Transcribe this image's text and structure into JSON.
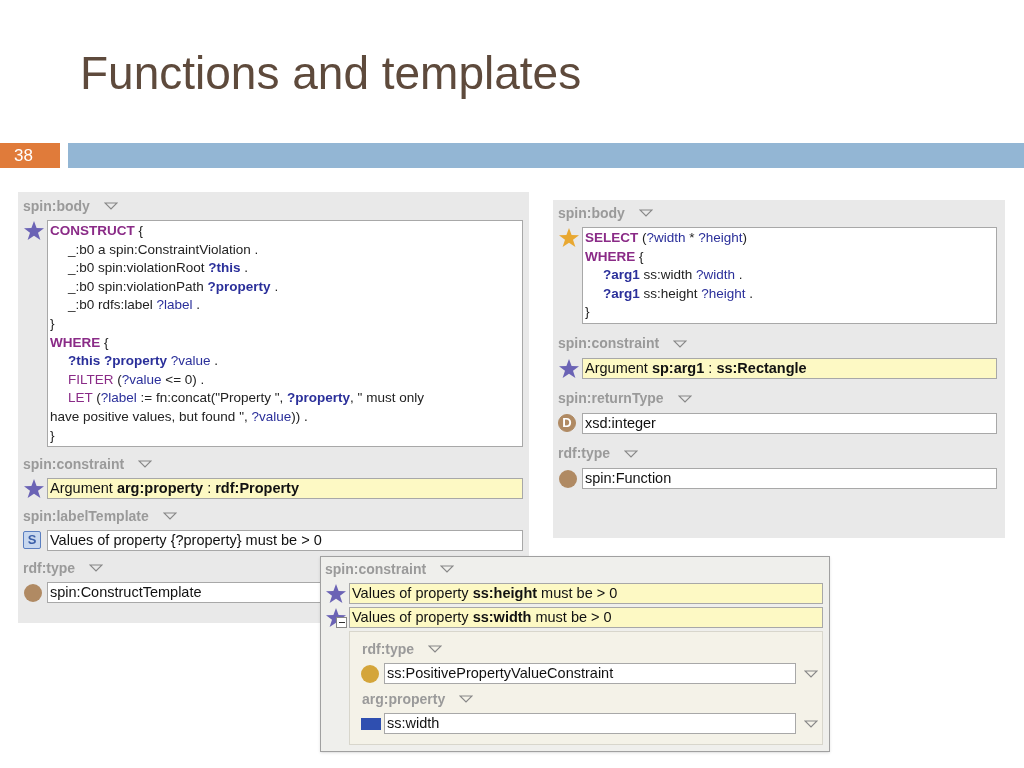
{
  "slide": {
    "title": "Functions and templates",
    "number": "38"
  },
  "panels": [
    {
      "properties": [
        {
          "label": "spin:body",
          "values": [
            {
              "kind": "code",
              "icon": {
                "kind": "star",
                "color": "#6b63b5"
              },
              "lines": [
                {
                  "indented": false,
                  "tokens": [
                    {
                      "kind": "keyword",
                      "text": "CONSTRUCT"
                    },
                    {
                      "kind": "plain",
                      "text": " {"
                    }
                  ]
                },
                {
                  "indented": true,
                  "tokens": [
                    {
                      "kind": "plain",
                      "text": "_:b0 a spin:ConstraintViolation ."
                    }
                  ]
                },
                {
                  "indented": true,
                  "tokens": [
                    {
                      "kind": "plain",
                      "text": "_:b0 spin:violationRoot "
                    },
                    {
                      "kind": "boundvar",
                      "text": "?this"
                    },
                    {
                      "kind": "plain",
                      "text": " ."
                    }
                  ]
                },
                {
                  "indented": true,
                  "tokens": [
                    {
                      "kind": "plain",
                      "text": "_:b0 spin:violationPath "
                    },
                    {
                      "kind": "boundvar",
                      "text": "?property"
                    },
                    {
                      "kind": "plain",
                      "text": " ."
                    }
                  ]
                },
                {
                  "indented": true,
                  "tokens": [
                    {
                      "kind": "plain",
                      "text": "_:b0 rdfs:label "
                    },
                    {
                      "kind": "var",
                      "text": "?label"
                    },
                    {
                      "kind": "plain",
                      "text": " ."
                    }
                  ]
                },
                {
                  "indented": false,
                  "tokens": [
                    {
                      "kind": "plain",
                      "text": "}"
                    }
                  ]
                },
                {
                  "indented": false,
                  "tokens": [
                    {
                      "kind": "keyword",
                      "text": "WHERE"
                    },
                    {
                      "kind": "plain",
                      "text": " {"
                    }
                  ]
                },
                {
                  "indented": true,
                  "tokens": [
                    {
                      "kind": "boundvar",
                      "text": "?this ?property"
                    },
                    {
                      "kind": "var",
                      "text": " ?value"
                    },
                    {
                      "kind": "plain",
                      "text": " ."
                    }
                  ]
                },
                {
                  "indented": true,
                  "tokens": [
                    {
                      "kind": "function",
                      "text": "FILTER"
                    },
                    {
                      "kind": "plain",
                      "text": " ("
                    },
                    {
                      "kind": "var",
                      "text": "?value"
                    },
                    {
                      "kind": "plain",
                      "text": " <= 0) ."
                    }
                  ]
                },
                {
                  "indented": true,
                  "tokens": [
                    {
                      "kind": "function",
                      "text": "LET"
                    },
                    {
                      "kind": "plain",
                      "text": " ("
                    },
                    {
                      "kind": "var",
                      "text": "?label"
                    },
                    {
                      "kind": "plain",
                      "text": " := fn:concat(\"Property \", "
                    },
                    {
                      "kind": "boundvar",
                      "text": "?property"
                    },
                    {
                      "kind": "plain",
                      "text": ", \" must only"
                    }
                  ]
                },
                {
                  "indented": false,
                  "tokens": [
                    {
                      "kind": "plain",
                      "text": "have positive values, but found \", "
                    },
                    {
                      "kind": "var",
                      "text": "?value"
                    },
                    {
                      "kind": "plain",
                      "text": ")) ."
                    }
                  ]
                },
                {
                  "indented": false,
                  "tokens": [
                    {
                      "kind": "plain",
                      "text": "}"
                    }
                  ]
                }
              ]
            }
          ]
        },
        {
          "label": "spin:constraint",
          "values": [
            {
              "kind": "text",
              "icon": {
                "kind": "star",
                "color": "#6b63b5"
              },
              "text": "Argument **arg:property** : **rdf:Property**",
              "highlighted": true,
              "dropdown": false
            }
          ]
        },
        {
          "label": "spin:labelTemplate",
          "values": [
            {
              "kind": "text",
              "icon": {
                "kind": "letter",
                "letter": "S",
                "color": "#5b7fc0"
              },
              "text": "Values of property {?property} must be > 0",
              "highlighted": false,
              "dropdown": false
            }
          ]
        },
        {
          "label": "rdf:type",
          "values": [
            {
              "kind": "text",
              "icon": {
                "kind": "dot",
                "color": "#b08a63"
              },
              "text": "spin:ConstructTemplate",
              "highlighted": false,
              "dropdown": false
            }
          ]
        }
      ]
    },
    {
      "properties": [
        {
          "label": "spin:body",
          "values": [
            {
              "kind": "code",
              "icon": {
                "kind": "star",
                "color": "#e8a832"
              },
              "lines": [
                {
                  "indented": false,
                  "tokens": [
                    {
                      "kind": "keyword",
                      "text": "SELECT"
                    },
                    {
                      "kind": "plain",
                      "text": " ("
                    },
                    {
                      "kind": "var",
                      "text": "?width"
                    },
                    {
                      "kind": "plain",
                      "text": " * "
                    },
                    {
                      "kind": "var",
                      "text": "?height"
                    },
                    {
                      "kind": "plain",
                      "text": ")"
                    }
                  ]
                },
                {
                  "indented": false,
                  "tokens": [
                    {
                      "kind": "keyword",
                      "text": "WHERE"
                    },
                    {
                      "kind": "plain",
                      "text": " {"
                    }
                  ]
                },
                {
                  "indented": true,
                  "tokens": [
                    {
                      "kind": "boundvar",
                      "text": "?arg1"
                    },
                    {
                      "kind": "plain",
                      "text": " ss:width "
                    },
                    {
                      "kind": "var",
                      "text": "?width"
                    },
                    {
                      "kind": "plain",
                      "text": " ."
                    }
                  ]
                },
                {
                  "indented": true,
                  "tokens": [
                    {
                      "kind": "boundvar",
                      "text": "?arg1"
                    },
                    {
                      "kind": "plain",
                      "text": " ss:height "
                    },
                    {
                      "kind": "var",
                      "text": "?height"
                    },
                    {
                      "kind": "plain",
                      "text": " ."
                    }
                  ]
                },
                {
                  "indented": false,
                  "tokens": [
                    {
                      "kind": "plain",
                      "text": "}"
                    }
                  ]
                }
              ]
            }
          ]
        },
        {
          "label": "spin:constraint",
          "values": [
            {
              "kind": "text",
              "icon": {
                "kind": "star",
                "color": "#6b63b5"
              },
              "text": "Argument **sp:arg1** : **ss:Rectangle**",
              "highlighted": true,
              "dropdown": false
            }
          ]
        },
        {
          "label": "spin:returnType",
          "values": [
            {
              "kind": "text",
              "icon": {
                "kind": "letter",
                "letter": "D",
                "color": "#b08a63"
              },
              "text": "xsd:integer",
              "highlighted": false,
              "dropdown": false
            }
          ]
        },
        {
          "label": "rdf:type",
          "values": [
            {
              "kind": "text",
              "icon": {
                "kind": "dot",
                "color": "#b08a63"
              },
              "text": "spin:Function",
              "highlighted": false,
              "dropdown": false
            }
          ]
        }
      ]
    },
    {
      "properties": [
        {
          "label": "spin:constraint",
          "values": [
            {
              "kind": "text",
              "icon": {
                "kind": "star",
                "color": "#6b63b5"
              },
              "text": "Values of property **ss:height** must be > 0",
              "highlighted": true,
              "dropdown": false
            },
            {
              "kind": "text",
              "icon": {
                "kind": "star",
                "color": "#6b63b5"
              },
              "text": "Values of property **ss:width** must be > 0",
              "highlighted": true,
              "dropdown": false,
              "expanded": true,
              "children": [
                {
                  "label": "rdf:type",
                  "values": [
                    {
                      "kind": "text",
                      "icon": {
                        "kind": "dot",
                        "color": "#d4a53a"
                      },
                      "text": "ss:PositivePropertyValueConstraint",
                      "highlighted": false,
                      "dropdown": true
                    }
                  ]
                },
                {
                  "label": "arg:property",
                  "values": [
                    {
                      "kind": "text",
                      "icon": {
                        "kind": "square",
                        "color": "#2f4fb0"
                      },
                      "text": "ss:width",
                      "highlighted": false,
                      "dropdown": true
                    }
                  ]
                }
              ]
            }
          ]
        }
      ]
    }
  ]
}
